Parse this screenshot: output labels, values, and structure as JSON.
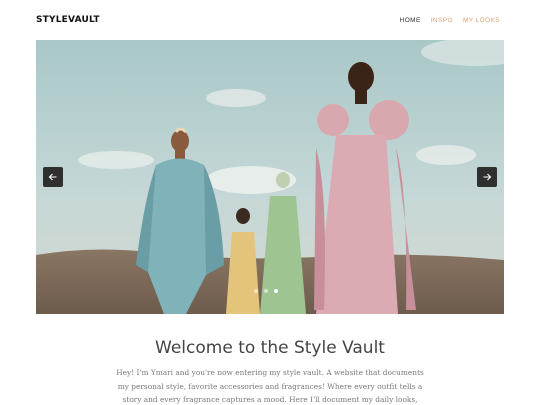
{
  "header": {
    "brand": "STYLEVAULT",
    "nav": [
      {
        "label": "HOME",
        "active": true
      },
      {
        "label": "INSPO",
        "active": false
      },
      {
        "label": "MY LOOKS",
        "active": false
      }
    ]
  },
  "carousel": {
    "prev_icon": "arrow-left-icon",
    "next_icon": "arrow-right-icon",
    "slide_count": 3,
    "active_slide": 3
  },
  "main": {
    "title": "Welcome to the Style Vault",
    "intro_lines": [
      "Hey! I'm Ymari and you're now entering my style vault. A website that documents",
      "my personal style, favorite accessories and fragrances! Where every outfit tells a",
      "story and every fragrance captures a mood. Here I'll document my daily looks,"
    ]
  },
  "colors": {
    "accent": "#e0a47a",
    "nav_active": "#333333",
    "arrow_bg": "#2f2f2f",
    "title": "#444444",
    "body_text": "#7a7a7a"
  }
}
